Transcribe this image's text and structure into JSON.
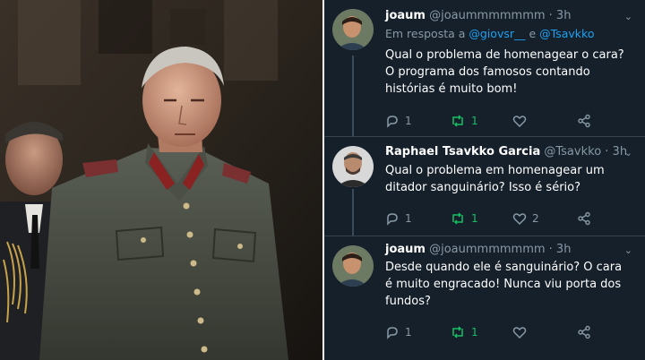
{
  "photo": {
    "icon": "military-portrait-photo"
  },
  "thread": {
    "tweets": [
      {
        "name": "joaum",
        "handle": "@joaummmmmmm",
        "time": "· 3h",
        "reply_prefix": "Em resposta a",
        "reply_mention_1": "@giovsr__",
        "reply_and": "e",
        "reply_mention_2": "@Tsavkko",
        "text": "Qual o problema de homenagear o cara?  O programa dos famosos contando histórias é muito bom!",
        "replies": "1",
        "retweets": "1",
        "likes": ""
      },
      {
        "name": "Raphael Tsavkko Garcia",
        "handle": "@Tsavkko",
        "time": "· 3h",
        "text": "Qual o problema em homenagear um ditador sanguinário? Isso é sério?",
        "replies": "1",
        "retweets": "1",
        "likes": "2"
      },
      {
        "name": "joaum",
        "handle": "@joaummmmmmm",
        "time": "· 3h",
        "text": "Desde quando ele é sanguinário? O cara é muito engracado! Nunca viu porta dos fundos?",
        "replies": "1",
        "retweets": "1",
        "likes": ""
      }
    ]
  },
  "colors": {
    "background": "#15202b",
    "text": "#ffffff",
    "secondary": "#8899a6",
    "link": "#1da1f2",
    "retweet": "#17bf63"
  }
}
